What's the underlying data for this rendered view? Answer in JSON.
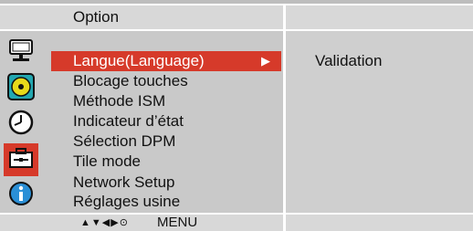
{
  "header": {
    "title": "Option"
  },
  "sidebar": {
    "icons": [
      {
        "name": "monitor-icon"
      },
      {
        "name": "audio-disc-icon"
      },
      {
        "name": "clock-icon"
      },
      {
        "name": "toolbox-icon",
        "active": true
      },
      {
        "name": "info-icon"
      }
    ]
  },
  "menu": {
    "items": [
      {
        "label": "Langue(Language)",
        "selected": true
      },
      {
        "label": "Blocage touches"
      },
      {
        "label": "Méthode ISM"
      },
      {
        "label": "Indicateur d’état"
      },
      {
        "label": "Sélection DPM"
      },
      {
        "label": "Tile mode"
      },
      {
        "label": "Network Setup"
      },
      {
        "label": "Réglages usine"
      }
    ],
    "arrow_glyph": "▶"
  },
  "submenu": {
    "value": "Validation"
  },
  "footer": {
    "nav_glyphs": "▲▼◀▶⊙",
    "menu_label": "MENU"
  },
  "colors": {
    "highlight": "#d63a2a",
    "panel": "#c9c9c9",
    "header": "#d8d8d8"
  }
}
